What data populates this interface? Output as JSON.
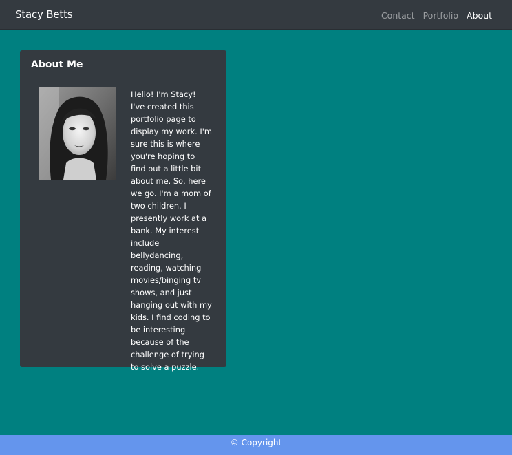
{
  "navbar": {
    "brand": "Stacy Betts",
    "links": [
      {
        "label": "Contact",
        "active": false
      },
      {
        "label": "Portfolio",
        "active": false
      },
      {
        "label": "About",
        "active": true
      }
    ]
  },
  "about": {
    "title": "About Me",
    "photo_alt": "portrait photo",
    "bio": "Hello! I'm Stacy! I've created this portfolio page to display my work. I'm sure this is where you're hoping to find out a little bit about me. So, here we go. I'm a mom of two children. I presently work at a bank. My interest include bellydancing, reading, watching movies/binging tv shows, and just hanging out with my kids. I find coding to be interesting because of the challenge of trying to solve a puzzle."
  },
  "footer": {
    "text": "© Copyright"
  },
  "colors": {
    "page_background": "#008080",
    "navbar": "#343a40",
    "card": "#343a40",
    "footer": "#6495ed"
  }
}
